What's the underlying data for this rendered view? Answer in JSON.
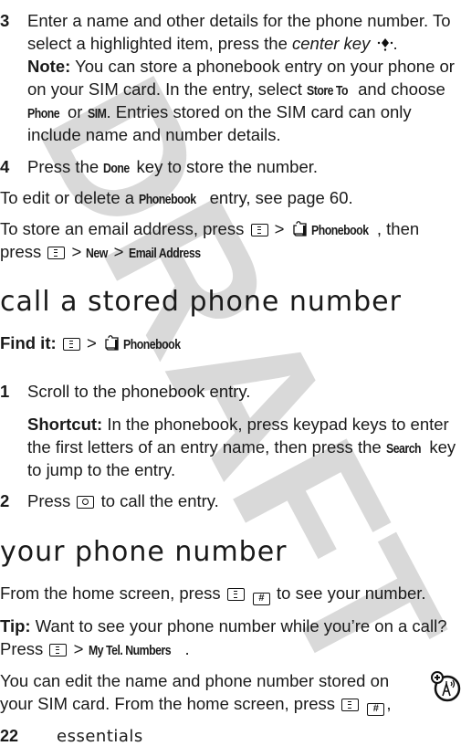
{
  "watermark": "DRAFT",
  "step3": {
    "number": "3",
    "line1": "Enter a name and other details for the phone number. To",
    "line2_pre": "select a highlighted item, press the ",
    "line2_em": "center key",
    "line2_post": ".",
    "note_label": "Note:",
    "note_line1": " You can store a phonebook entry on your phone or",
    "note_line2_pre": "on your SIM card. In the entry, select ",
    "note_store_to": "Store To",
    "note_line2_post": " and choose",
    "note_phone": "Phone",
    "note_or": " or ",
    "note_sim": "SIM",
    "note_line3_post": ". Entries stored on the SIM card can only",
    "note_line4": "include name and number details."
  },
  "step4": {
    "number": "4",
    "pre": "Press the ",
    "done": "Done",
    "post": " key to store the number."
  },
  "edit_para": {
    "pre": "To edit or delete a ",
    "phonebook": "Phonebook",
    "post": " entry, see page 60."
  },
  "email_para": {
    "line1_pre": "To store an email address, press ",
    "gt": ">",
    "phonebook": "Phonebook",
    "line1_post": ", then",
    "line2_pre": "press ",
    "new": "New",
    "email_address": "Email Address"
  },
  "section1": {
    "title": "call a stored phone number",
    "find_it_label": "Find it:",
    "gt": ">",
    "phonebook": "Phonebook",
    "step1_number": "1",
    "step1_text": "Scroll to the phonebook entry.",
    "shortcut_label": "Shortcut:",
    "shortcut_line1": " In the phonebook, press keypad keys to enter",
    "shortcut_line2_pre": "the first letters of an entry name, then press the ",
    "search": "Search",
    "shortcut_line2_post": " key",
    "shortcut_line3": "to jump to the entry.",
    "step2_number": "2",
    "step2_pre": "Press ",
    "step2_post": " to call the entry."
  },
  "section2": {
    "title": "your phone number",
    "home_pre": "From the home screen, press ",
    "home_hash": "#",
    "home_post": " to see your number.",
    "tip_label": "Tip:",
    "tip_line1": " Want to see your phone number while you’re on a call?",
    "tip_line2_pre": "Press ",
    "gt": ">",
    "my_tel_numbers": "My Tel. Numbers",
    "tip_line2_post": ".",
    "edit_line1": "You can edit the name and phone number stored on",
    "edit_line2_pre": "your SIM card. From the home screen, press ",
    "edit_hash": "#",
    "edit_line2_post": ","
  },
  "footer": {
    "page_number": "22",
    "section": "essentials"
  },
  "icons": {
    "menu_key": "menu-key-icon",
    "phonebook": "phonebook-icon",
    "center_key": "center-key-icon",
    "send_key": "send-key-icon",
    "hash_key": "hash-key-icon",
    "sim_feature": "network-sim-feature-icon"
  }
}
